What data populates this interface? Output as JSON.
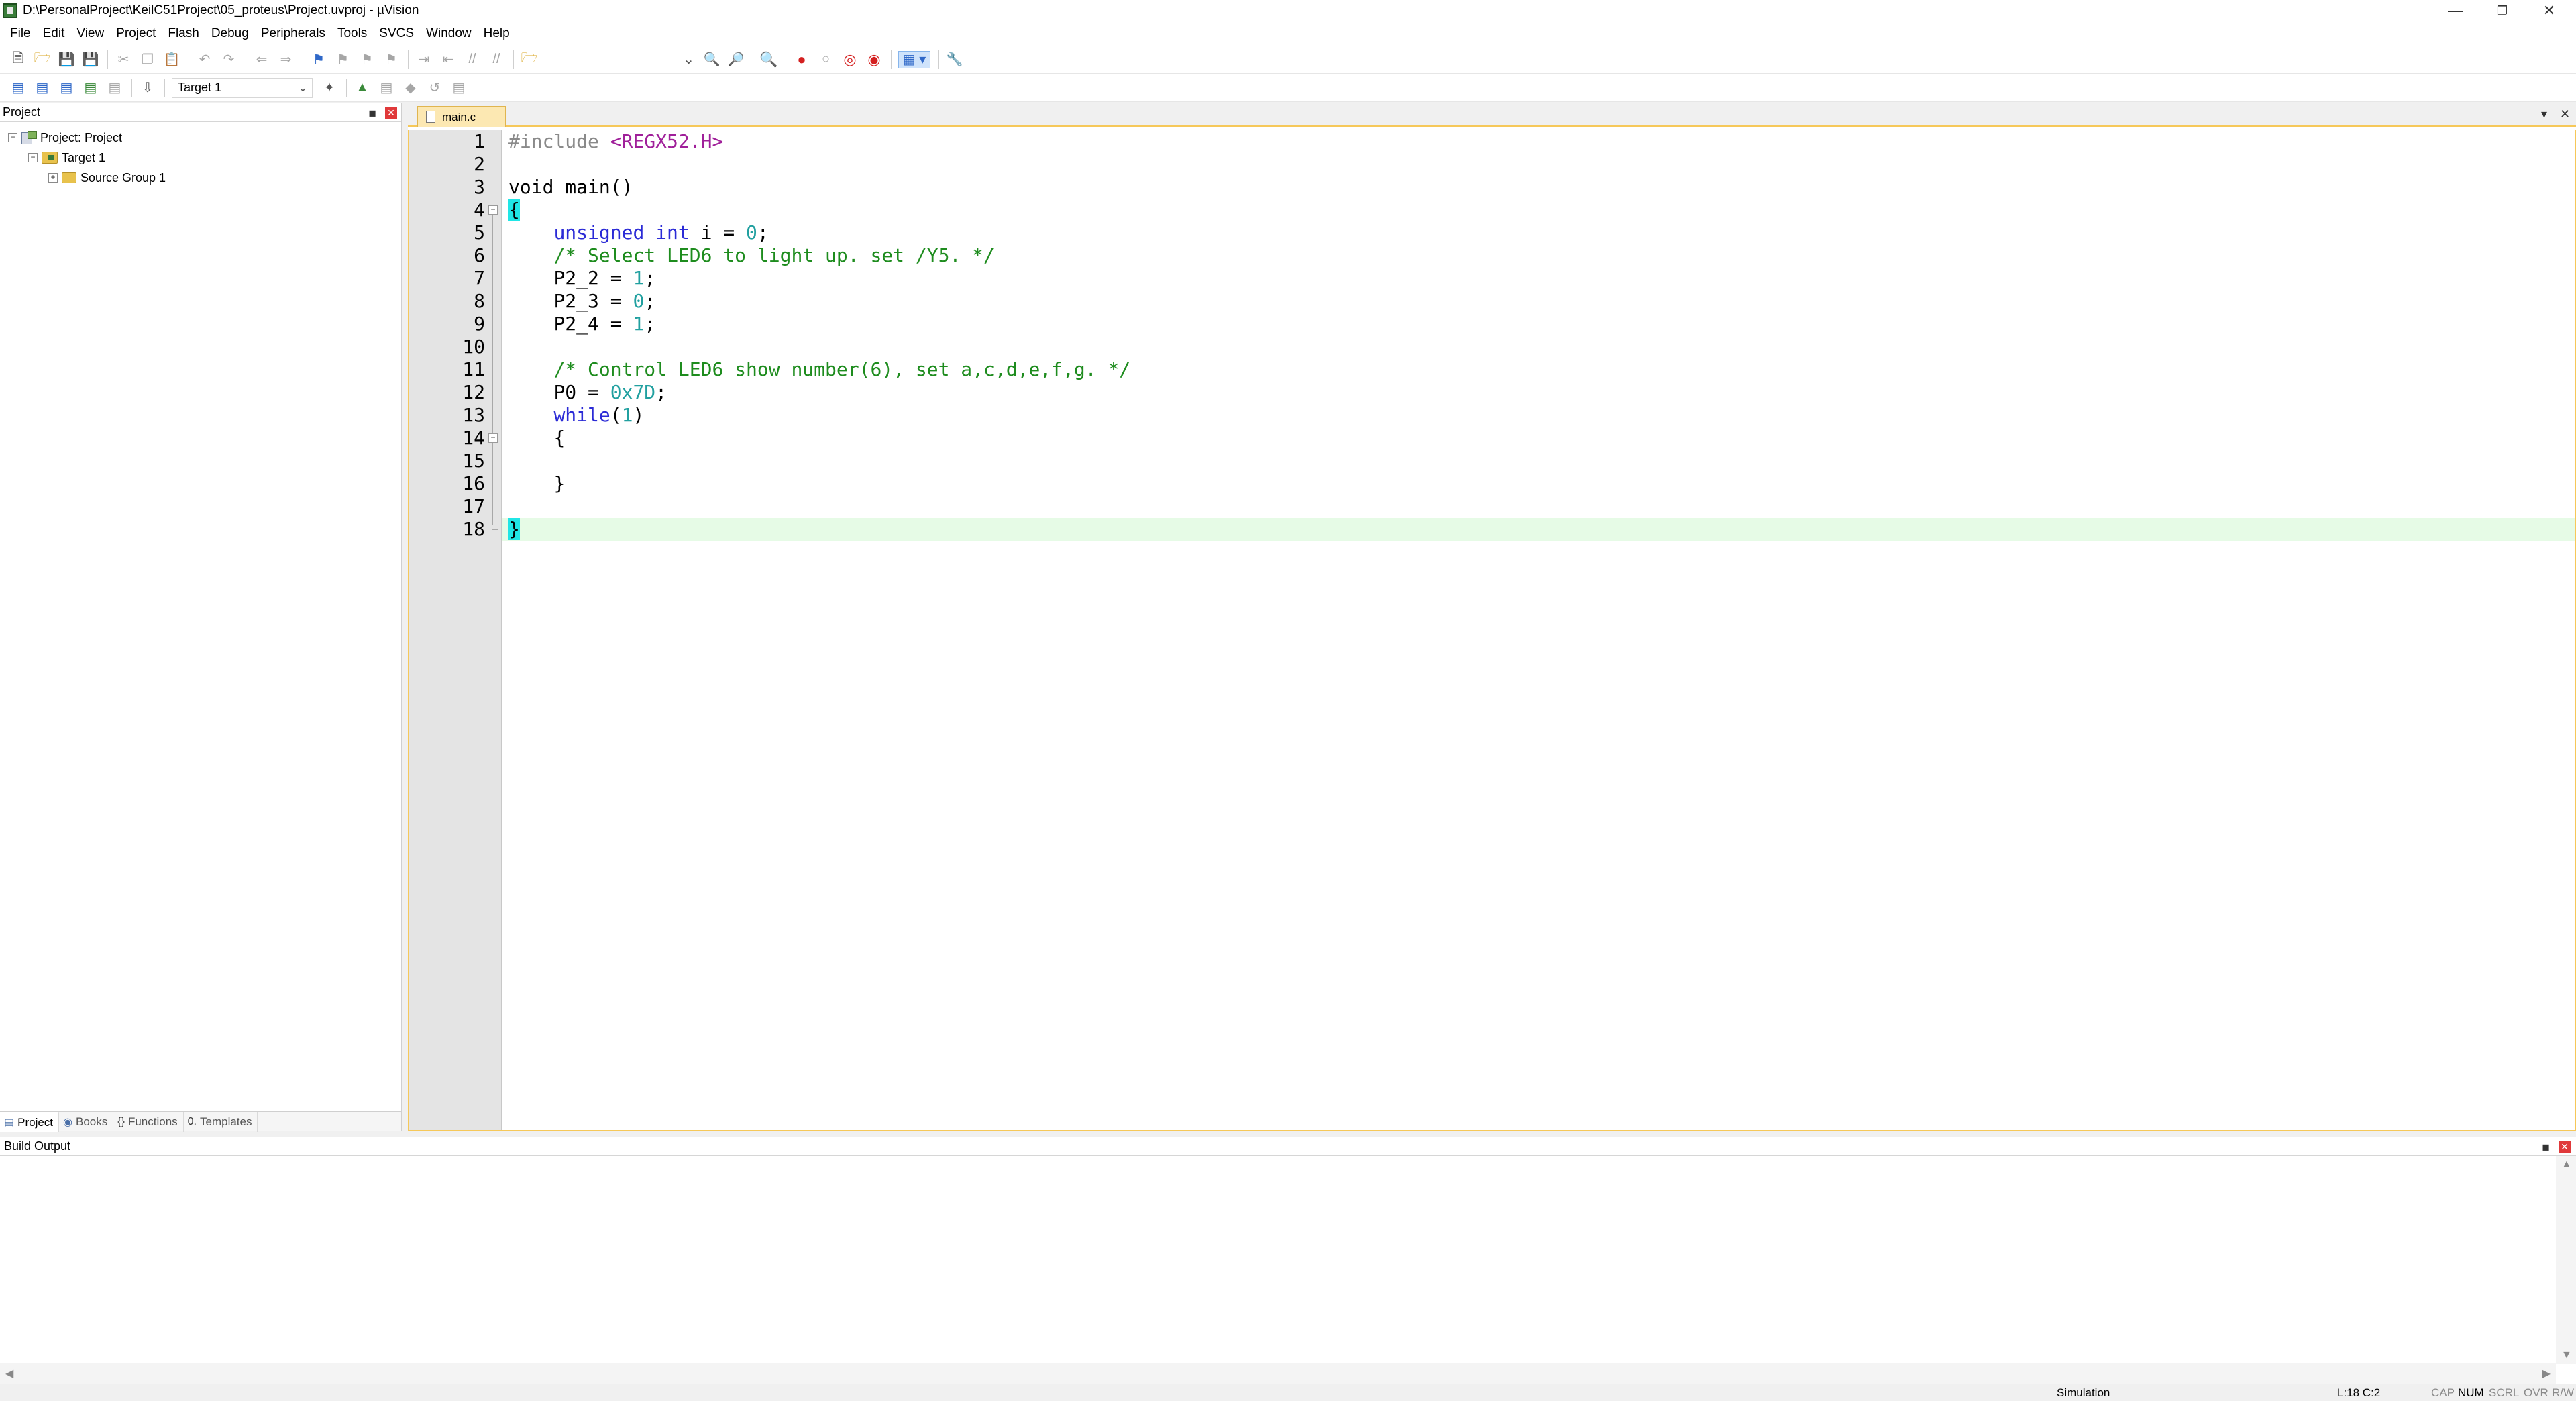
{
  "window": {
    "title": "D:\\PersonalProject\\KeilC51Project\\05_proteus\\Project.uvproj - µVision"
  },
  "menu": [
    "File",
    "Edit",
    "View",
    "Project",
    "Flash",
    "Debug",
    "Peripherals",
    "Tools",
    "SVCS",
    "Window",
    "Help"
  ],
  "toolbar": {
    "target": "Target 1"
  },
  "project_pane": {
    "header": "Project",
    "tree": {
      "root": "Project: Project",
      "target": "Target 1",
      "group": "Source Group 1"
    },
    "tabs": [
      "Project",
      "Books",
      "Functions",
      "Templates"
    ]
  },
  "editor": {
    "file_tab": "main.c",
    "line_numbers": [
      "1",
      "2",
      "3",
      "4",
      "5",
      "6",
      "7",
      "8",
      "9",
      "10",
      "11",
      "12",
      "13",
      "14",
      "15",
      "16",
      "17",
      "18"
    ],
    "code": {
      "l1_pp": "#include ",
      "l1_hdr": "<REGX52.H>",
      "l3": "void main()",
      "l4": "{",
      "l5_kw": "unsigned int",
      "l5_rest": " i = ",
      "l5_num": "0",
      "l5_end": ";",
      "l6": "/* Select LED6 to light up. set /Y5. */",
      "l7_a": "P2_2 = ",
      "l7_n": "1",
      "l7_e": ";",
      "l8_a": "P2_3 = ",
      "l8_n": "0",
      "l8_e": ";",
      "l9_a": "P2_4 = ",
      "l9_n": "1",
      "l9_e": ";",
      "l11": "/* Control LED6 show number(6), set a,c,d,e,f,g. */",
      "l12_a": "P0 = ",
      "l12_n": "0x7D",
      "l12_e": ";",
      "l13_kw": "while",
      "l13_a": "(",
      "l13_n": "1",
      "l13_e": ")",
      "l14": "{",
      "l16": "}",
      "l18": "}"
    }
  },
  "build_output": {
    "header": "Build Output"
  },
  "status": {
    "mode": "Simulation",
    "position": "L:18 C:2",
    "cap": "CAP",
    "num": "NUM",
    "scrl": "SCRL",
    "ovr": "OVR",
    "rw": "R/W"
  }
}
